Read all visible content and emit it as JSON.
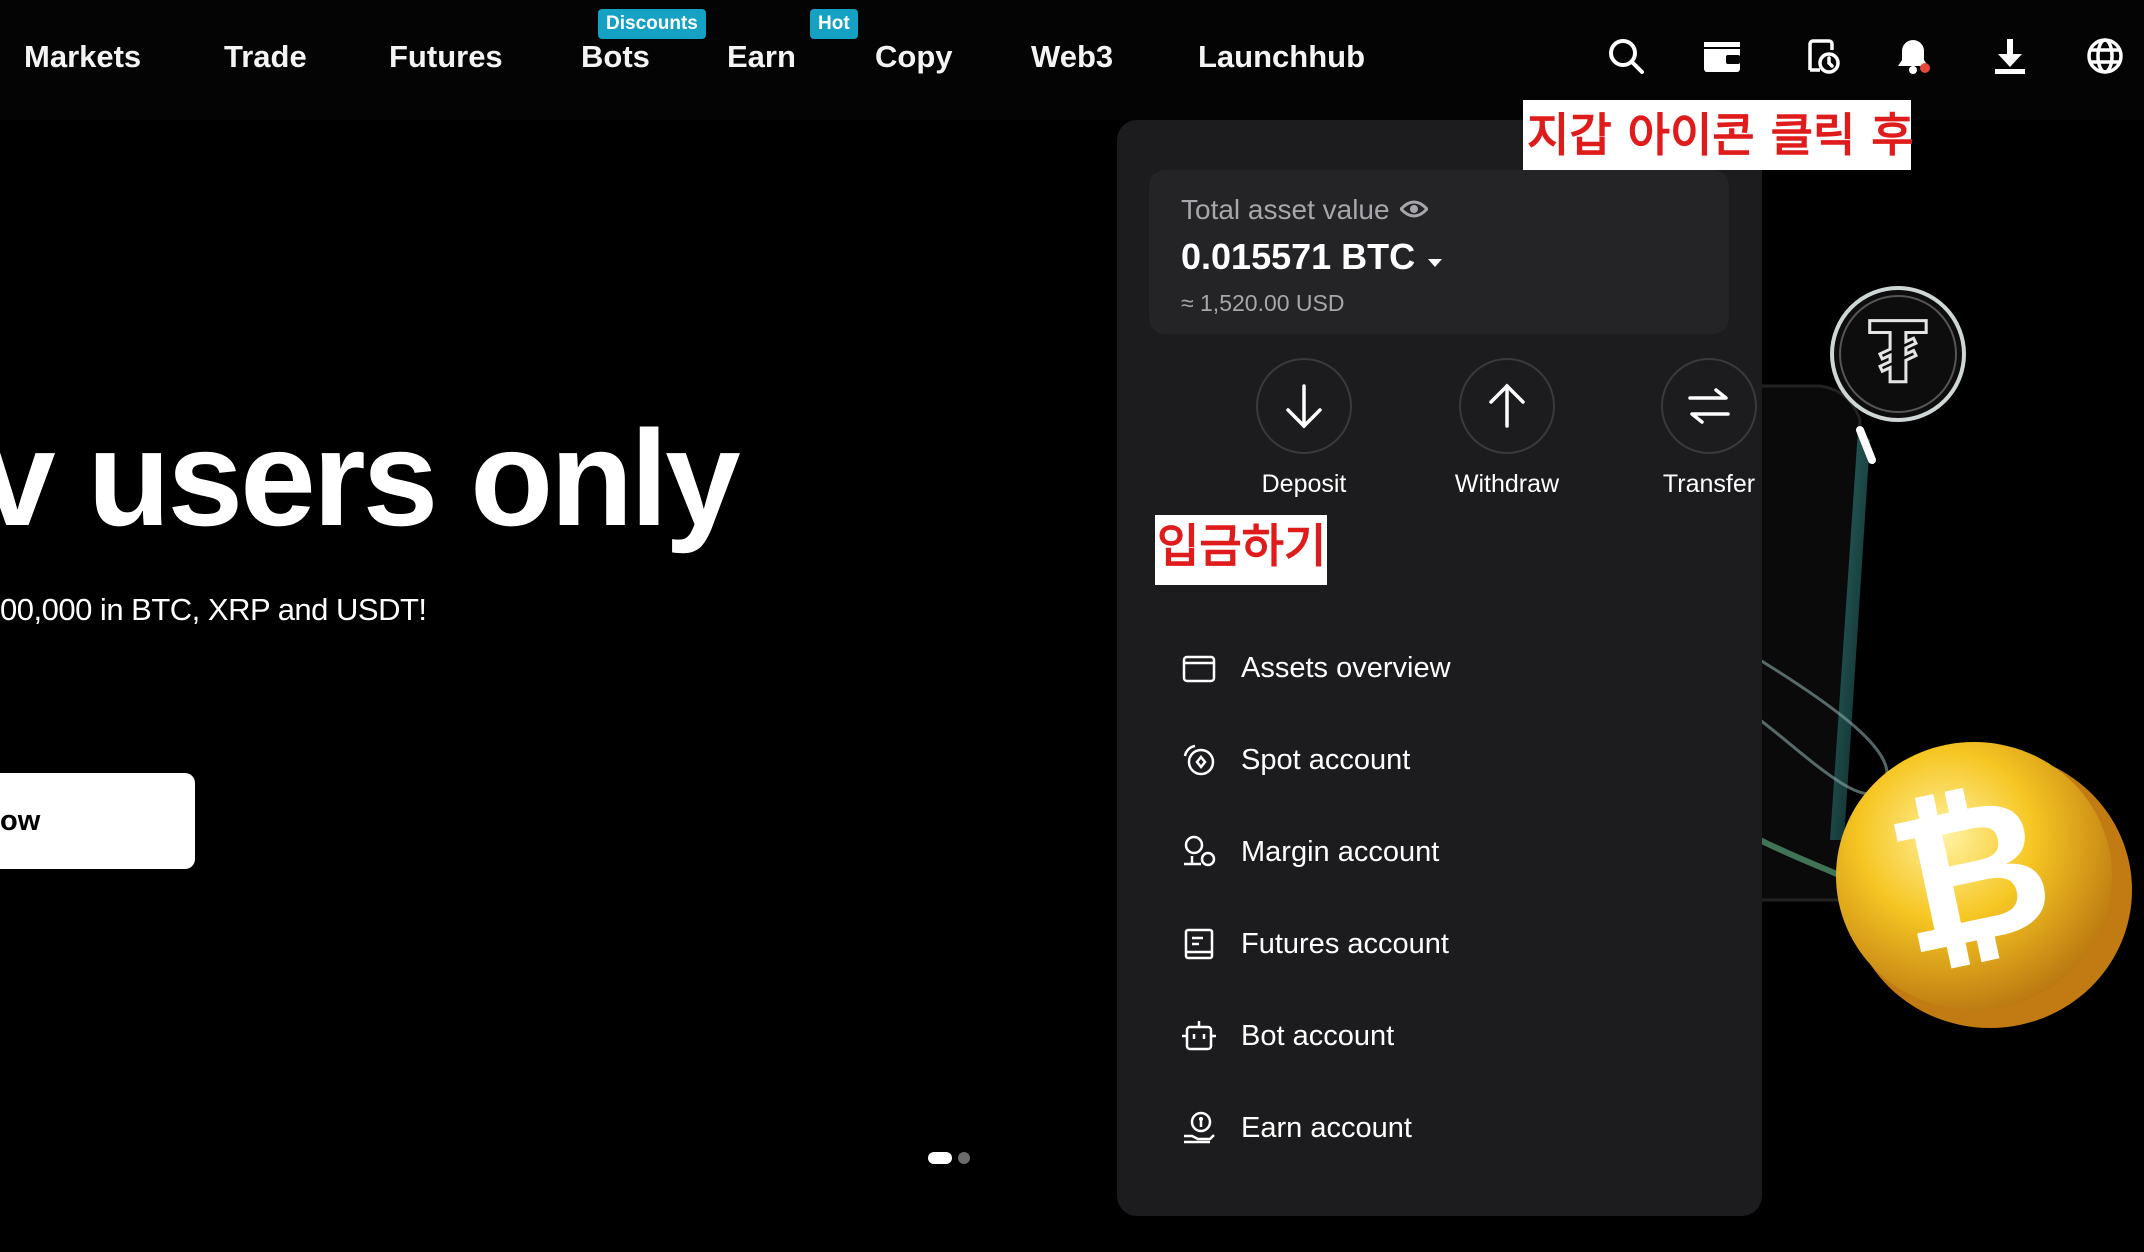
{
  "nav": {
    "items": [
      {
        "label": "Markets"
      },
      {
        "label": "Trade"
      },
      {
        "label": "Futures"
      },
      {
        "label": "Bots",
        "badge": "Discounts"
      },
      {
        "label": "Earn"
      },
      {
        "label": "Copy",
        "badge": "Hot"
      },
      {
        "label": "Web3"
      },
      {
        "label": "Launchhub"
      }
    ],
    "icons": [
      "search-icon",
      "wallet-icon",
      "order-history-icon",
      "notification-bell-icon",
      "download-icon",
      "language-globe-icon"
    ]
  },
  "hero": {
    "title": "v users only",
    "subtitle": "00,000 in BTC, XRP and USDT!",
    "cta_label": "ow"
  },
  "wallet": {
    "total_label": "Total asset value",
    "btc_value": "0.015571 BTC",
    "usd_value": "≈ 1,520.00 USD",
    "actions": [
      {
        "label": "Deposit"
      },
      {
        "label": "Withdraw"
      },
      {
        "label": "Transfer"
      }
    ],
    "menu": [
      {
        "label": "Assets overview"
      },
      {
        "label": "Spot account"
      },
      {
        "label": "Margin account"
      },
      {
        "label": "Futures account"
      },
      {
        "label": "Bot account"
      },
      {
        "label": "Earn account"
      }
    ]
  },
  "annotations": {
    "wallet_click": "지갑 아이콘 클릭 후",
    "deposit": "입금하기"
  },
  "carousel": {
    "active": 1,
    "total": 2
  },
  "colors": {
    "badge": "#14a1c4",
    "panel": "#1c1c1e",
    "annotation_text": "#e01b1b",
    "notification_dot": "#e5483a"
  }
}
